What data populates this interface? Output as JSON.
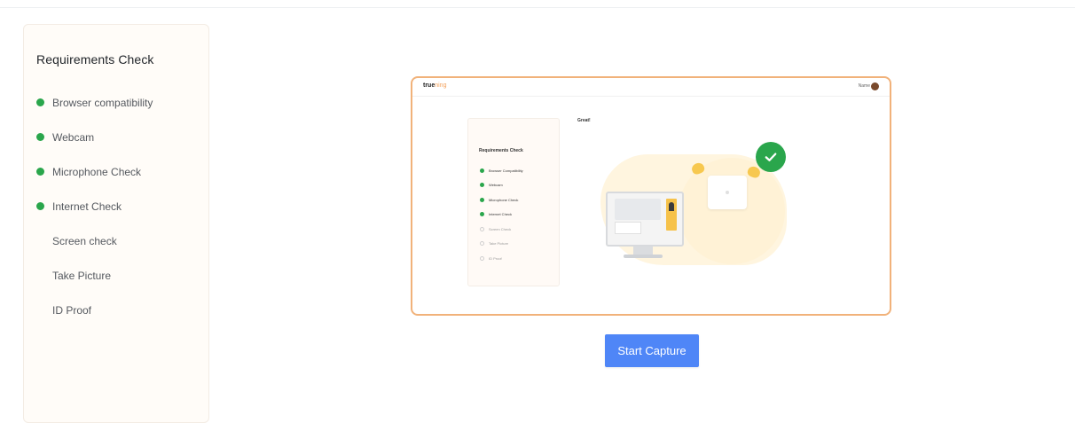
{
  "requirements_panel": {
    "title": "Requirements Check",
    "items": [
      {
        "label": "Browser compatibility",
        "status": "complete"
      },
      {
        "label": "Webcam",
        "status": "complete"
      },
      {
        "label": "Microphone Check",
        "status": "complete"
      },
      {
        "label": "Internet Check",
        "status": "complete"
      },
      {
        "label": "Screen check",
        "status": "pending"
      },
      {
        "label": "Take Picture",
        "status": "pending"
      },
      {
        "label": "ID Proof",
        "status": "pending"
      }
    ]
  },
  "preview": {
    "logo_bold": "true",
    "logo_light": "ning",
    "user_label": "Name",
    "heading": "Great!",
    "card_title": "Requirements Check",
    "items": [
      {
        "label": "Browser Compatibility",
        "status": "complete"
      },
      {
        "label": "Webcam",
        "status": "complete"
      },
      {
        "label": "Microphone Check",
        "status": "complete"
      },
      {
        "label": "Internet Check",
        "status": "complete"
      },
      {
        "label": "Screen Check",
        "status": "pending"
      },
      {
        "label": "Take Picture",
        "status": "pending"
      },
      {
        "label": "ID Proof",
        "status": "pending"
      }
    ]
  },
  "start_button": {
    "label": "Start Capture"
  },
  "icons": {
    "status_complete": "green-dot-icon",
    "success": "check-circle-icon",
    "monitor": "monitor-icon"
  },
  "colors": {
    "accent": "#4f86f7",
    "success": "#2aa64c",
    "frame_border": "#f1b27a",
    "illustration_yellow": "#f7c84f"
  }
}
